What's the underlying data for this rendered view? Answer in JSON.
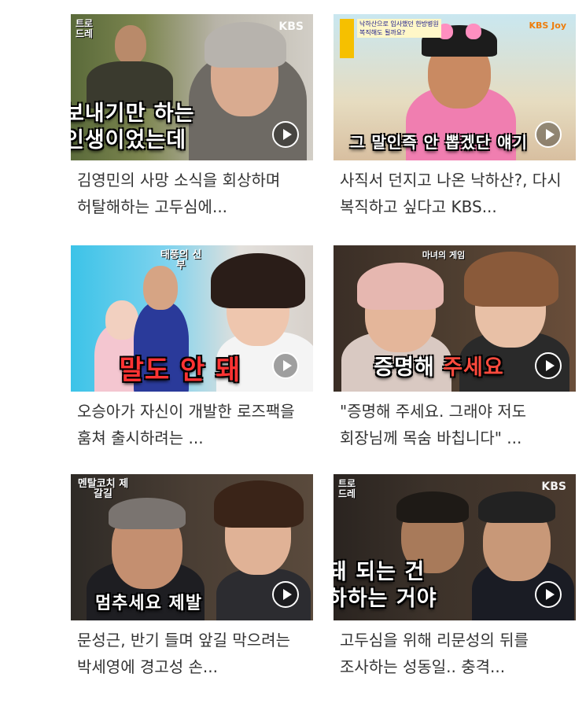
{
  "icons": {
    "play": "play-circle-icon"
  },
  "videos": [
    {
      "title": "김영민의 사망 소식을 회상하며 허탈해하는 고두심에...",
      "caption_line1": "보내기만 하는",
      "caption_line2": "인생이었는데",
      "brand": "KBS",
      "show_logo": "트로 드레"
    },
    {
      "title": "사직서 던지고 나온 낙하산?, 다시 복직하고 싶다고 KBS...",
      "caption_line1": "그 말인즉 안 뽑겠단 얘기",
      "brand": "KBS Joy",
      "topic_line1": "낙하산으로 입사했던 한방병원",
      "topic_line2": "복직해도 될까요?"
    },
    {
      "title": "오승아가 자신이 개발한 로즈팩을 훔쳐 출시하려는 ...",
      "caption_line1": "말도 안 돼",
      "show_logo": "태풍의 신부"
    },
    {
      "title": "\"증명해 주세요. 그래야 저도 회장님께 목숨 바칩니다\" ...",
      "caption_pre": "증명해 ",
      "caption_hl": "주세요",
      "show_logo": "마녀의 게임"
    },
    {
      "title": "문성근, 반기 들며 앞길 막으려는 박세영에 경고성 손...",
      "caption_line1": "멈추세요 제발",
      "show_logo": "멘탈코치 제갈길"
    },
    {
      "title": "고두심을 위해 리문성의 뒤를 조사하는 성동일.. 충격...",
      "caption_line1": "돼 되는 건",
      "caption_line2": "하하는 거야",
      "brand": "KBS",
      "show_logo": "트로 드레"
    }
  ]
}
